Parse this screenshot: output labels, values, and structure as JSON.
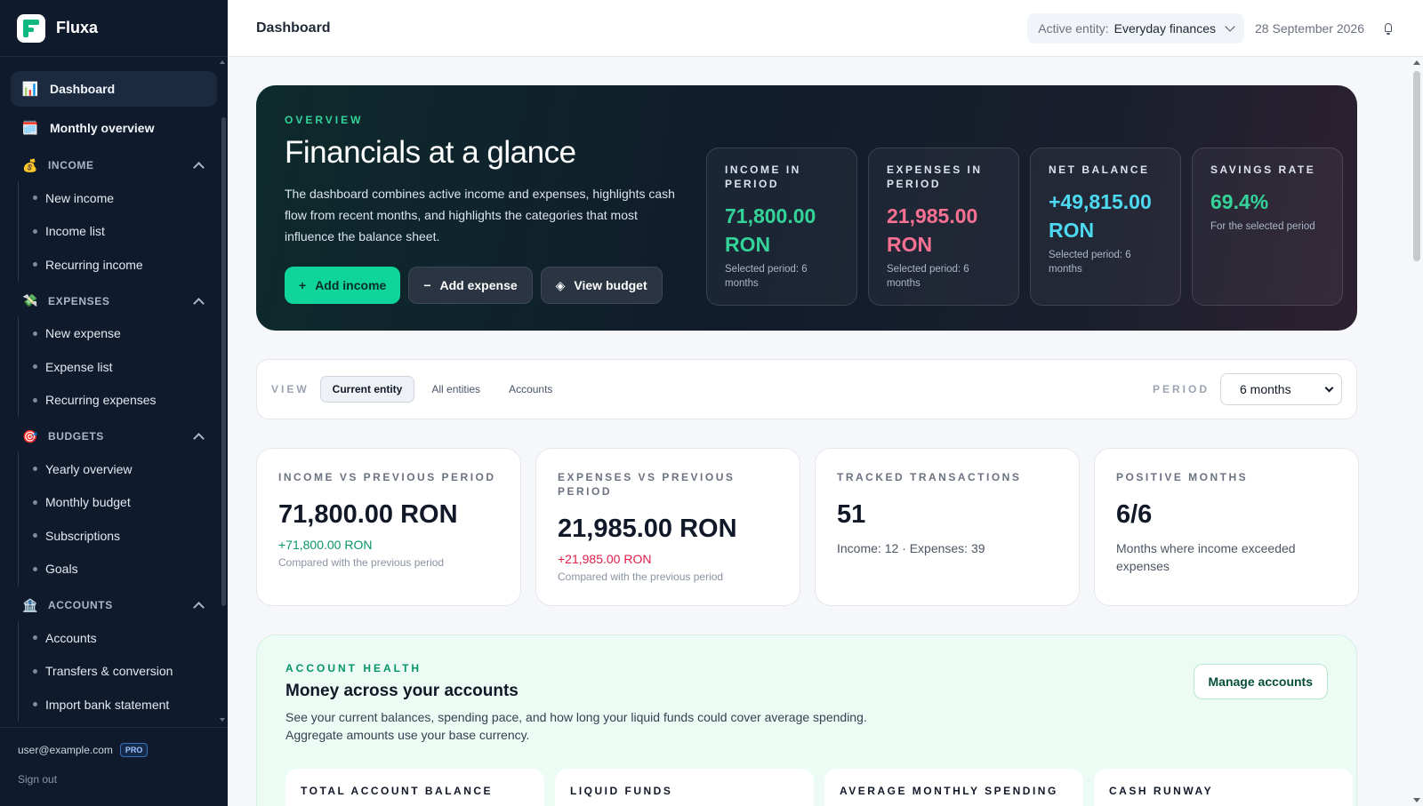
{
  "app": {
    "name": "Fluxa"
  },
  "sidebar": {
    "top_items": [
      {
        "label": "Dashboard",
        "icon": "bar-chart-icon",
        "emoji": "📊"
      },
      {
        "label": "Monthly overview",
        "icon": "calendar-icon",
        "emoji": "🗓️"
      }
    ],
    "sections": [
      {
        "label": "INCOME",
        "emoji": "💰",
        "icon": "money-bag-icon",
        "items": [
          "New income",
          "Income list",
          "Recurring income"
        ]
      },
      {
        "label": "EXPENSES",
        "emoji": "💸",
        "icon": "money-wings-icon",
        "items": [
          "New expense",
          "Expense list",
          "Recurring expenses"
        ]
      },
      {
        "label": "BUDGETS",
        "emoji": "🎯",
        "icon": "target-icon",
        "items": [
          "Yearly overview",
          "Monthly budget",
          "Subscriptions",
          "Goals"
        ]
      },
      {
        "label": "ACCOUNTS",
        "emoji": "🏦",
        "icon": "bank-icon",
        "items": [
          "Accounts",
          "Transfers & conversion",
          "Import bank statement"
        ]
      }
    ],
    "footer": {
      "email": "user@example.com",
      "badge": "PRO",
      "sign_out": "Sign out"
    }
  },
  "topbar": {
    "title": "Dashboard",
    "entity_label": "Active entity:",
    "entity_value": "Everyday finances",
    "date": "28 September 2026"
  },
  "hero": {
    "eyebrow": "OVERVIEW",
    "title": "Financials at a glance",
    "description": "The dashboard combines active income and expenses, highlights cash flow from recent months, and highlights the categories that most influence the balance sheet.",
    "actions": [
      {
        "icon": "+",
        "label": "Add income"
      },
      {
        "icon": "−",
        "label": "Add expense"
      },
      {
        "icon": "◈",
        "label": "View budget"
      }
    ],
    "stats": [
      {
        "label": "INCOME IN PERIOD",
        "value": "71,800.00 RON",
        "sub": "Selected period: 6 months"
      },
      {
        "label": "EXPENSES IN PERIOD",
        "value": "21,985.00 RON",
        "sub": "Selected period: 6 months"
      },
      {
        "label": "NET BALANCE",
        "value": "+49,815.00 RON",
        "sub": "Selected period: 6 months"
      },
      {
        "label": "SAVINGS RATE",
        "value": "69.4%",
        "sub": "For the selected period"
      }
    ],
    "colors": {
      "income": "#34d399",
      "expense": "#f87193",
      "net": "#4dd9f0",
      "accent": "#10d59a"
    }
  },
  "viewbar": {
    "view_label": "VIEW",
    "tabs": [
      "Current entity",
      "All entities",
      "Accounts"
    ],
    "period_label": "PERIOD",
    "period_value": "6 months"
  },
  "metrics": [
    {
      "label": "INCOME VS PREVIOUS PERIOD",
      "value": "71,800.00 RON",
      "delta": "+71,800.00 RON",
      "note": "Compared with the previous period"
    },
    {
      "label": "EXPENSES VS PREVIOUS PERIOD",
      "value": "21,985.00 RON",
      "delta": "+21,985.00 RON",
      "note": "Compared with the previous period"
    },
    {
      "label": "TRACKED TRANSACTIONS",
      "value": "51",
      "text": "Income: 12 · Expenses: 39"
    },
    {
      "label": "POSITIVE MONTHS",
      "value": "6/6",
      "text": "Months where income exceeded expenses"
    }
  ],
  "account_health": {
    "eyebrow": "ACCOUNT HEALTH",
    "title": "Money across your accounts",
    "description": "See your current balances, spending pace, and how long your liquid funds could cover average spending. Aggregate amounts use your base currency.",
    "button": "Manage accounts",
    "cards": [
      "TOTAL ACCOUNT BALANCE",
      "LIQUID FUNDS",
      "AVERAGE MONTHLY SPENDING",
      "CASH RUNWAY"
    ]
  }
}
